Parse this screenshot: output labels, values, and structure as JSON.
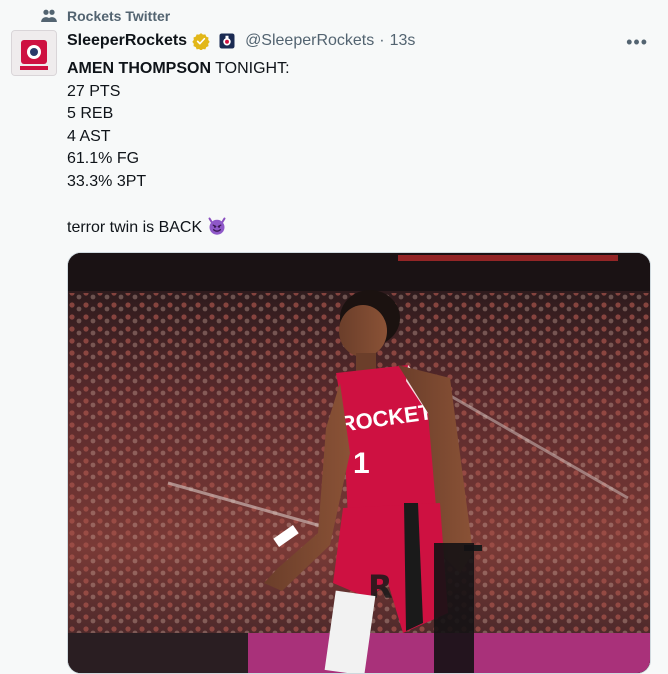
{
  "context": {
    "label": "Rockets Twitter",
    "icon": "community-icon"
  },
  "tweet": {
    "display_name": "SleeperRockets",
    "handle": "@SleeperRockets",
    "separator": "·",
    "time": "13s",
    "more_label": "•••",
    "badge_icon": "verified-badge-icon",
    "affiliate_icon": "affiliate-badge-icon",
    "avatar_icon": "sleeper-rockets-avatar",
    "text": {
      "headline_bold": "AMEN THOMPSON",
      "headline_rest": " TONIGHT:",
      "stats": [
        "27 PTS",
        "5 REB",
        "4 AST",
        "61.1% FG",
        "33.3% 3PT"
      ],
      "closing": "terror twin is BACK "
    },
    "emoji": "smiling-devil-emoji",
    "media": {
      "jersey_text": "ROCKETS",
      "jersey_number": "1"
    }
  },
  "colors": {
    "accent_verified": "#e2b719",
    "rockets_red": "#ce1141",
    "muted_text": "#536471"
  }
}
